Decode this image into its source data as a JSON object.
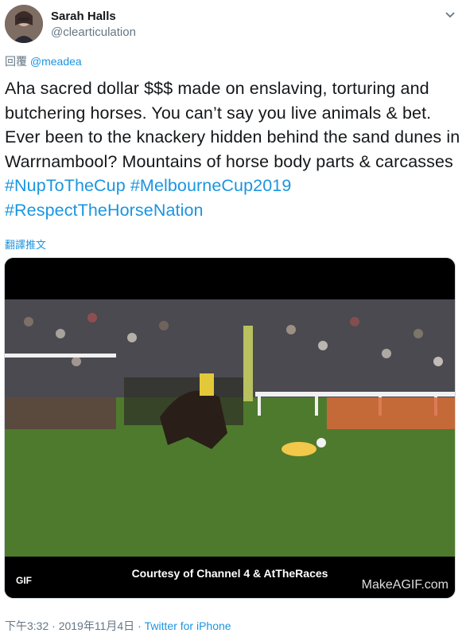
{
  "user": {
    "name": "Sarah Halls",
    "handle": "@clearticulation"
  },
  "reply": {
    "prefix": "回覆",
    "mention": "@meadea"
  },
  "tweet": {
    "text": "Aha sacred dollar $$$ made on enslaving, torturing and butchering horses. You can’t say you live animals & bet. Ever been to the knackery hidden behind the sand dunes in Warrnambool? Mountains of horse body parts & carcasses",
    "hashtags": [
      "#NupToTheCup",
      "#MelbourneCup2019",
      "#RespectTheHorseNation"
    ]
  },
  "translate_label": "翻譯推文",
  "media": {
    "badge": "GIF",
    "caption": "Courtesy of Channel 4 & AtTheRaces",
    "watermark": "MakeAGIF.com"
  },
  "footer": {
    "time": "下午3:32",
    "date": "2019年11月4日",
    "separator": "·",
    "source": "Twitter for iPhone"
  },
  "icons": {
    "menu": "chevron-down-icon",
    "avatar": "avatar"
  }
}
